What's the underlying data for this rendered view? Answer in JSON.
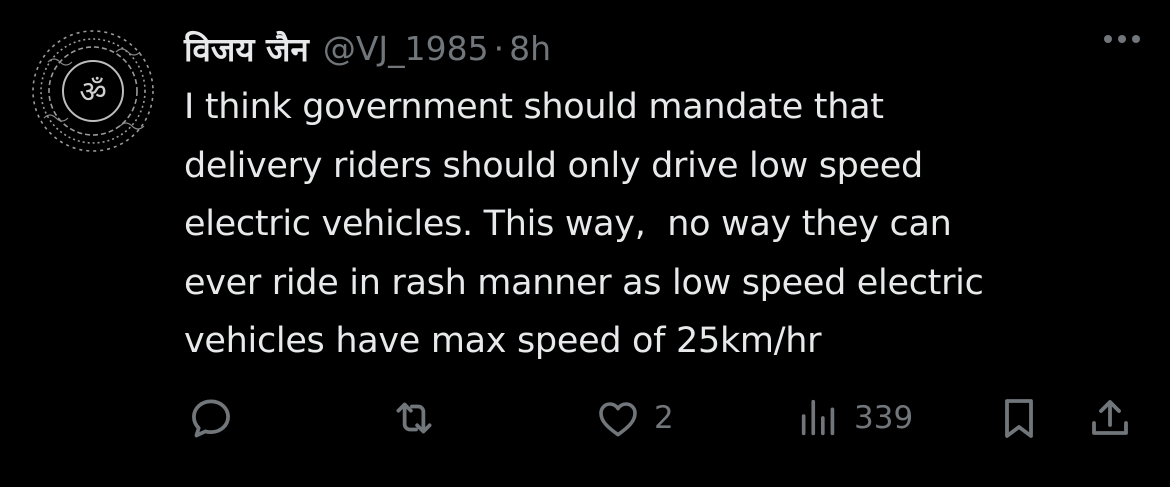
{
  "tweet": {
    "display_name": "विजय जैन",
    "handle": "@VJ_1985",
    "separator": "·",
    "time": "8h",
    "text": "I think government should mandate that\ndelivery riders should only drive low speed\nelectric vehicles. This way,  no way they can\never ride in rash manner as low speed electric\nvehicles have max speed of 25km/hr"
  },
  "actions": {
    "reply_icon": "reply-icon",
    "retweet_icon": "retweet-icon",
    "like_icon": "heart-icon",
    "like_count": "2",
    "views_icon": "views-icon",
    "views_count": "339",
    "bookmark_icon": "bookmark-icon",
    "share_icon": "share-icon"
  },
  "colors": {
    "background": "#000000",
    "text": "#e7e9ea",
    "secondary": "#71767b"
  }
}
